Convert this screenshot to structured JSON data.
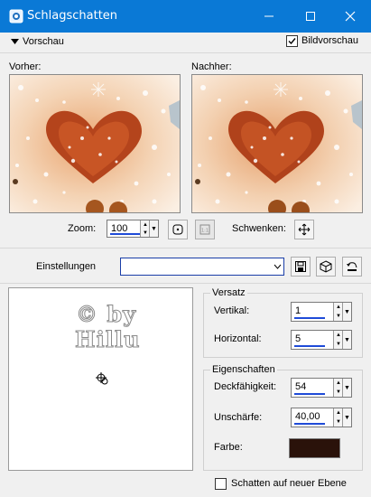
{
  "window": {
    "title": "Schlagschatten"
  },
  "header": {
    "preview_toggle": "Vorschau",
    "live_preview_label": "Bildvorschau",
    "live_preview_checked": true
  },
  "preview": {
    "before_label": "Vorher:",
    "after_label": "Nachher:"
  },
  "zoom": {
    "label": "Zoom:",
    "value": "100"
  },
  "pan": {
    "label": "Schwenken:"
  },
  "settings": {
    "label": "Einstellungen",
    "value": ""
  },
  "canvas": {
    "watermark_line1": "© by",
    "watermark_line2": "Hillu"
  },
  "offset": {
    "title": "Versatz",
    "vertical_label": "Vertikal:",
    "vertical_value": "1",
    "horizontal_label": "Horizontal:",
    "horizontal_value": "5"
  },
  "properties": {
    "title": "Eigenschaften",
    "opacity_label": "Deckfähigkeit:",
    "opacity_value": "54",
    "blur_label": "Unschärfe:",
    "blur_value": "40,00",
    "color_label": "Farbe:",
    "color": "#2a120a"
  },
  "footer": {
    "shadow_new_layer_label": "Schatten auf neuer Ebene",
    "shadow_new_layer_checked": false
  },
  "colors": {
    "titlebar": "#0a79d6",
    "accent_underline": "#1f4bd8"
  }
}
